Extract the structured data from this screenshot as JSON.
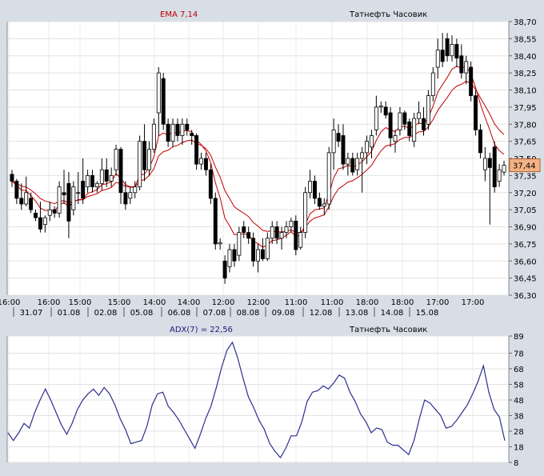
{
  "chart_data": [
    {
      "type": "candlestick",
      "indicator_label": "EMA 7,14",
      "instrument_label": "Татнефть Часовик",
      "y_ticks": [
        "38,70",
        "38,55",
        "38,40",
        "38,25",
        "38,10",
        "37,95",
        "37,80",
        "37,65",
        "37,50",
        "37,35",
        "37,20",
        "37,05",
        "36,90",
        "36,75",
        "36,60",
        "36,45",
        "36,30"
      ],
      "ylim": [
        36.3,
        38.7
      ],
      "last_price_label": "37,44",
      "last_price": 37.44,
      "x_time_labels": [
        "16:00",
        "16:00",
        "15:00",
        "15:00",
        "14:00",
        "14:00",
        "12:00",
        "12:00",
        "11:00",
        "11:00",
        "18:00",
        "18:00",
        "17:00",
        "17:00"
      ],
      "x_date_labels": [
        "31.07",
        "01.08",
        "02.08",
        "05.08",
        "06.08",
        "07.08",
        "08.08",
        "09.08",
        "12.08",
        "13.08",
        "14.08",
        "15.08"
      ],
      "grid": true,
      "colors": {
        "up_candle": "#ffffff",
        "down_candle": "#000000",
        "ema": "#c00000",
        "last_price_box": "#f4b183"
      },
      "candles": [
        {
          "o": 37.36,
          "h": 37.4,
          "l": 37.25,
          "c": 37.3
        },
        {
          "o": 37.3,
          "h": 37.32,
          "l": 37.1,
          "c": 37.15
        },
        {
          "o": 37.15,
          "h": 37.28,
          "l": 37.05,
          "c": 37.1
        },
        {
          "o": 37.1,
          "h": 37.34,
          "l": 37.08,
          "c": 37.2
        },
        {
          "o": 37.15,
          "h": 37.2,
          "l": 37.02,
          "c": 37.05
        },
        {
          "o": 37.02,
          "h": 37.05,
          "l": 36.95,
          "c": 36.98
        },
        {
          "o": 36.98,
          "h": 37.12,
          "l": 36.85,
          "c": 36.88
        },
        {
          "o": 36.92,
          "h": 37.0,
          "l": 36.85,
          "c": 36.98
        },
        {
          "o": 37.0,
          "h": 37.12,
          "l": 36.95,
          "c": 37.05
        },
        {
          "o": 37.05,
          "h": 37.08,
          "l": 36.98,
          "c": 37.02
        },
        {
          "o": 37.02,
          "h": 37.3,
          "l": 36.98,
          "c": 37.25
        },
        {
          "o": 37.2,
          "h": 37.4,
          "l": 37.1,
          "c": 37.18
        },
        {
          "o": 37.28,
          "h": 37.38,
          "l": 36.8,
          "c": 36.95
        },
        {
          "o": 37.05,
          "h": 37.3,
          "l": 37.0,
          "c": 37.25
        },
        {
          "o": 37.2,
          "h": 37.38,
          "l": 37.1,
          "c": 37.2
        },
        {
          "o": 37.3,
          "h": 37.5,
          "l": 37.1,
          "c": 37.15
        },
        {
          "o": 37.25,
          "h": 37.4,
          "l": 37.2,
          "c": 37.35
        },
        {
          "o": 37.35,
          "h": 37.4,
          "l": 37.2,
          "c": 37.25
        },
        {
          "o": 37.25,
          "h": 37.3,
          "l": 37.2,
          "c": 37.28
        },
        {
          "o": 37.28,
          "h": 37.5,
          "l": 37.22,
          "c": 37.4
        },
        {
          "o": 37.4,
          "h": 37.5,
          "l": 37.25,
          "c": 37.3
        },
        {
          "o": 37.3,
          "h": 37.42,
          "l": 37.25,
          "c": 37.35
        },
        {
          "o": 37.4,
          "h": 37.62,
          "l": 37.35,
          "c": 37.58
        },
        {
          "o": 37.58,
          "h": 37.6,
          "l": 37.1,
          "c": 37.2
        },
        {
          "o": 37.2,
          "h": 37.3,
          "l": 37.05,
          "c": 37.1
        },
        {
          "o": 37.15,
          "h": 37.25,
          "l": 37.1,
          "c": 37.2
        },
        {
          "o": 37.2,
          "h": 37.3,
          "l": 37.15,
          "c": 37.25
        },
        {
          "o": 37.25,
          "h": 37.7,
          "l": 37.22,
          "c": 37.65
        },
        {
          "o": 37.65,
          "h": 37.8,
          "l": 37.3,
          "c": 37.4
        },
        {
          "o": 37.4,
          "h": 37.65,
          "l": 37.35,
          "c": 37.58
        },
        {
          "o": 37.58,
          "h": 37.85,
          "l": 37.55,
          "c": 37.8
        },
        {
          "o": 37.9,
          "h": 38.3,
          "l": 37.7,
          "c": 38.25
        },
        {
          "o": 38.2,
          "h": 38.25,
          "l": 37.75,
          "c": 37.8
        },
        {
          "o": 37.8,
          "h": 37.85,
          "l": 37.6,
          "c": 37.65
        },
        {
          "o": 37.65,
          "h": 37.85,
          "l": 37.6,
          "c": 37.8
        },
        {
          "o": 37.8,
          "h": 37.85,
          "l": 37.65,
          "c": 37.7
        },
        {
          "o": 37.7,
          "h": 37.85,
          "l": 37.62,
          "c": 37.8
        },
        {
          "o": 37.8,
          "h": 37.85,
          "l": 37.7,
          "c": 37.75
        },
        {
          "o": 37.72,
          "h": 37.75,
          "l": 37.62,
          "c": 37.7
        },
        {
          "o": 37.7,
          "h": 37.72,
          "l": 37.4,
          "c": 37.45
        },
        {
          "o": 37.45,
          "h": 37.55,
          "l": 37.4,
          "c": 37.5
        },
        {
          "o": 37.5,
          "h": 37.55,
          "l": 37.35,
          "c": 37.4
        },
        {
          "o": 37.4,
          "h": 37.45,
          "l": 37.1,
          "c": 37.15
        },
        {
          "o": 37.15,
          "h": 37.2,
          "l": 36.7,
          "c": 36.75
        },
        {
          "o": 36.75,
          "h": 36.8,
          "l": 36.7,
          "c": 36.76
        },
        {
          "o": 36.6,
          "h": 36.65,
          "l": 36.4,
          "c": 36.45
        },
        {
          "o": 36.55,
          "h": 36.75,
          "l": 36.5,
          "c": 36.7
        },
        {
          "o": 36.7,
          "h": 36.75,
          "l": 36.55,
          "c": 36.6
        },
        {
          "o": 36.65,
          "h": 36.9,
          "l": 36.6,
          "c": 36.85
        },
        {
          "o": 36.9,
          "h": 36.95,
          "l": 36.8,
          "c": 36.85
        },
        {
          "o": 36.85,
          "h": 36.9,
          "l": 36.75,
          "c": 36.8
        },
        {
          "o": 36.8,
          "h": 36.85,
          "l": 36.55,
          "c": 36.6
        },
        {
          "o": 36.6,
          "h": 36.75,
          "l": 36.5,
          "c": 36.7
        },
        {
          "o": 36.7,
          "h": 36.8,
          "l": 36.6,
          "c": 36.62
        },
        {
          "o": 36.62,
          "h": 36.85,
          "l": 36.6,
          "c": 36.8
        },
        {
          "o": 36.8,
          "h": 36.95,
          "l": 36.75,
          "c": 36.9
        },
        {
          "o": 36.9,
          "h": 36.95,
          "l": 36.75,
          "c": 36.8
        },
        {
          "o": 36.8,
          "h": 36.9,
          "l": 36.7,
          "c": 36.85
        },
        {
          "o": 36.85,
          "h": 36.95,
          "l": 36.8,
          "c": 36.9
        },
        {
          "o": 36.9,
          "h": 36.98,
          "l": 36.85,
          "c": 36.95
        },
        {
          "o": 36.95,
          "h": 37.0,
          "l": 36.65,
          "c": 36.7
        },
        {
          "o": 36.72,
          "h": 36.9,
          "l": 36.7,
          "c": 36.85
        },
        {
          "o": 36.85,
          "h": 37.25,
          "l": 36.8,
          "c": 37.2
        },
        {
          "o": 37.2,
          "h": 37.4,
          "l": 37.15,
          "c": 37.3
        },
        {
          "o": 37.3,
          "h": 37.35,
          "l": 37.1,
          "c": 37.15
        },
        {
          "o": 37.15,
          "h": 37.2,
          "l": 37.05,
          "c": 37.08
        },
        {
          "o": 37.08,
          "h": 37.15,
          "l": 37.0,
          "c": 37.1
        },
        {
          "o": 37.1,
          "h": 37.6,
          "l": 37.05,
          "c": 37.55
        },
        {
          "o": 37.55,
          "h": 37.85,
          "l": 37.4,
          "c": 37.75
        },
        {
          "o": 37.72,
          "h": 37.8,
          "l": 37.6,
          "c": 37.65
        },
        {
          "o": 37.7,
          "h": 37.8,
          "l": 37.4,
          "c": 37.45
        },
        {
          "o": 37.45,
          "h": 37.55,
          "l": 37.35,
          "c": 37.5
        },
        {
          "o": 37.5,
          "h": 37.55,
          "l": 37.35,
          "c": 37.38
        },
        {
          "o": 37.4,
          "h": 37.55,
          "l": 37.35,
          "c": 37.5
        },
        {
          "o": 37.5,
          "h": 37.6,
          "l": 37.2,
          "c": 37.55
        },
        {
          "o": 37.55,
          "h": 37.7,
          "l": 37.45,
          "c": 37.65
        },
        {
          "o": 37.6,
          "h": 37.75,
          "l": 37.5,
          "c": 37.7
        },
        {
          "o": 37.75,
          "h": 38.05,
          "l": 37.7,
          "c": 37.95
        },
        {
          "o": 37.95,
          "h": 38.0,
          "l": 37.9,
          "c": 37.96
        },
        {
          "o": 37.95,
          "h": 38.0,
          "l": 37.85,
          "c": 37.88
        },
        {
          "o": 37.9,
          "h": 37.95,
          "l": 37.6,
          "c": 37.68
        },
        {
          "o": 37.65,
          "h": 37.75,
          "l": 37.55,
          "c": 37.7
        },
        {
          "o": 37.75,
          "h": 37.95,
          "l": 37.7,
          "c": 37.9
        },
        {
          "o": 37.9,
          "h": 37.92,
          "l": 37.75,
          "c": 37.8
        },
        {
          "o": 37.82,
          "h": 37.85,
          "l": 37.65,
          "c": 37.7
        },
        {
          "o": 37.65,
          "h": 37.9,
          "l": 37.6,
          "c": 37.85
        },
        {
          "o": 37.85,
          "h": 38.0,
          "l": 37.8,
          "c": 37.9
        },
        {
          "o": 37.85,
          "h": 37.95,
          "l": 37.7,
          "c": 37.75
        },
        {
          "o": 37.8,
          "h": 38.1,
          "l": 37.75,
          "c": 38.05
        },
        {
          "o": 38.05,
          "h": 38.3,
          "l": 38.0,
          "c": 38.25
        },
        {
          "o": 38.3,
          "h": 38.55,
          "l": 38.2,
          "c": 38.45
        },
        {
          "o": 38.45,
          "h": 38.6,
          "l": 38.3,
          "c": 38.35
        },
        {
          "o": 38.55,
          "h": 38.6,
          "l": 38.35,
          "c": 38.4
        },
        {
          "o": 38.4,
          "h": 38.58,
          "l": 38.35,
          "c": 38.5
        },
        {
          "o": 38.5,
          "h": 38.55,
          "l": 38.3,
          "c": 38.38
        },
        {
          "o": 38.4,
          "h": 38.5,
          "l": 38.2,
          "c": 38.25
        },
        {
          "o": 38.25,
          "h": 38.4,
          "l": 38.15,
          "c": 38.35
        },
        {
          "o": 38.3,
          "h": 38.35,
          "l": 38.0,
          "c": 38.05
        },
        {
          "o": 38.05,
          "h": 38.1,
          "l": 37.7,
          "c": 37.75
        },
        {
          "o": 37.75,
          "h": 37.8,
          "l": 37.5,
          "c": 37.55
        },
        {
          "o": 37.4,
          "h": 37.6,
          "l": 37.3,
          "c": 37.5
        },
        {
          "o": 37.5,
          "h": 37.55,
          "l": 36.92,
          "c": 37.42
        },
        {
          "o": 37.6,
          "h": 37.65,
          "l": 37.2,
          "c": 37.25
        },
        {
          "o": 37.3,
          "h": 37.45,
          "l": 37.25,
          "c": 37.4
        },
        {
          "o": 37.38,
          "h": 37.48,
          "l": 37.35,
          "c": 37.44
        }
      ]
    },
    {
      "type": "line",
      "indicator_label": "ADX(7) = 22,56",
      "instrument_label": "Татнефть Часовик",
      "y_ticks": [
        "89",
        "78",
        "68",
        "58",
        "48",
        "38",
        "28",
        "18",
        "8"
      ],
      "ylim": [
        8,
        89
      ],
      "grid": true,
      "colors": {
        "line": "#2e2e8e"
      },
      "values": [
        27,
        22,
        27,
        33,
        30,
        40,
        48,
        55,
        48,
        40,
        32,
        26,
        33,
        42,
        48,
        52,
        55,
        51,
        56,
        52,
        45,
        36,
        29,
        20,
        21,
        22,
        31,
        45,
        52,
        53,
        44,
        40,
        35,
        29,
        23,
        17,
        26,
        36,
        44,
        56,
        69,
        80,
        85,
        75,
        62,
        50,
        43,
        35,
        29,
        20,
        15,
        11,
        17,
        25,
        25,
        34,
        47,
        53,
        54,
        57,
        55,
        59,
        64,
        62,
        53,
        47,
        39,
        34,
        27,
        30,
        29,
        21,
        19,
        19,
        16,
        13,
        22,
        36,
        48,
        46,
        42,
        38,
        30,
        31,
        35,
        40,
        45,
        52,
        60,
        70,
        53,
        42,
        37,
        22
      ]
    }
  ]
}
